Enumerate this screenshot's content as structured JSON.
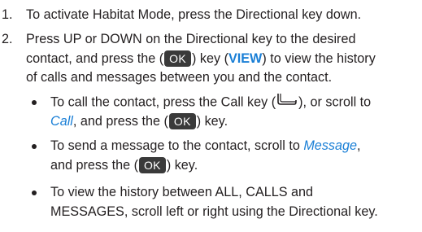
{
  "steps": [
    {
      "number": "1.",
      "text": "To activate Habitat Mode, press the Directional key down."
    },
    {
      "number": "2.",
      "line1": "Press UP or DOWN on the Directional key to the desired",
      "line2_pre": "contact, and press the (",
      "line2_key": "OK",
      "line2_mid": ") key (",
      "line2_link": "VIEW",
      "line2_post": ") to view the history",
      "line3": "of calls and messages between you and the contact."
    }
  ],
  "bullets": [
    {
      "line1_pre": "To call the contact, press the Call key (",
      "line1_icon": "call-key-icon",
      "line1_post": "), or scroll to",
      "line2_link": "Call",
      "line2_pre": ", and press the (",
      "line2_key": "OK",
      "line2_post": ") key."
    },
    {
      "line1_pre": "To send a message to the contact, scroll to ",
      "line1_link": "Message",
      "line1_post": ",",
      "line2_pre": "and press the (",
      "line2_key": "OK",
      "line2_post": ") key."
    },
    {
      "line1": "To view the history between ALL, CALLS and",
      "line2": "MESSAGES, scroll left or right using the Directional key."
    }
  ],
  "colors": {
    "text": "#231f20",
    "link": "#1a7fd6",
    "key_bg": "#3a3a3a"
  }
}
